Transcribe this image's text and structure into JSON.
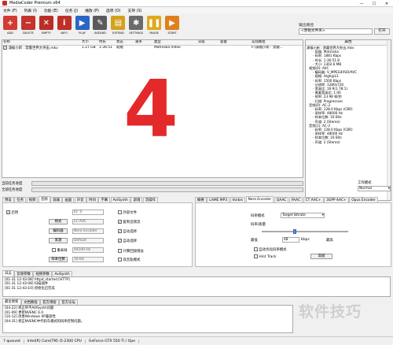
{
  "window": {
    "title": "MediaCoder Premium x64",
    "min": "—",
    "max": "☐",
    "close": "✕"
  },
  "menu": [
    "文件 (F)",
    "列表 (I)",
    "功能 (E)",
    "任务 (J)",
    "播放 (P)",
    "选项 (O)",
    "支持 (S)"
  ],
  "toolbar": [
    {
      "label": "ADD",
      "icon": "add-icon",
      "color": "#d23b32",
      "glyph": "+"
    },
    {
      "label": "DELETE",
      "icon": "delete-icon",
      "color": "#c4342c",
      "glyph": "−"
    },
    {
      "label": "EMPTY",
      "icon": "empty-icon",
      "color": "#b92e27",
      "glyph": "✕"
    },
    {
      "label": "INFO",
      "icon": "info-icon",
      "color": "#bf2f29",
      "glyph": "i"
    },
    {
      "label": "PLAY",
      "icon": "play-icon",
      "color": "#2a66c8",
      "glyph": "▶"
    },
    {
      "label": "WIZARD",
      "icon": "wizard-icon",
      "color": "#5a5a5a",
      "glyph": "✎"
    },
    {
      "label": "EXTEND",
      "icon": "extend-icon",
      "color": "#d4a020",
      "glyph": "▤"
    },
    {
      "label": "SETTINGS",
      "icon": "settings-icon",
      "color": "#6b6b6b",
      "glyph": "✱"
    },
    {
      "label": "PAUSE",
      "icon": "pause-icon",
      "color": "#e0a81c",
      "glyph": "❚❚"
    },
    {
      "label": "START",
      "icon": "start-icon",
      "color": "#e0801c",
      "glyph": "▶"
    }
  ],
  "output": {
    "label": "输出路径",
    "value": "<原始文件夹>",
    "browse": "打开"
  },
  "filelist": {
    "columns": [
      "名称",
      "大小",
      "时长",
      "状态",
      "速率",
      "类型",
      "分段",
      "容量",
      "实际路径"
    ],
    "rows": [
      [
        "浦福小新 : 禁震世界大突击.mkv",
        "1.27 GB",
        "1:36:51",
        "就绪",
        "",
        "Matroska Video",
        "",
        "",
        "F:\\浦福小新 : 禁震..."
      ]
    ]
  },
  "overlay_number": "4",
  "properties": {
    "header": "属性",
    "items": [
      "浦福小新 : 禁震世界大突击.mkv",
      "· 容器: Matroska",
      "· 码率: 1881 Kbps",
      "· 时长: 1:36:51.8",
      "· 大小: 1302.6 MB",
      "视频(0): AVC",
      "· 编码器: V_MPEG4/ISO/AVC",
      "· 规格: High@L3",
      "· 码率: 1500 Kbps",
      "· 分辨率: 1280x720",
      "· 宽高比: 16:9(1.78:1)",
      "· 像素宽高比: 1.00",
      "· 帧率: 23.98 帧/秒",
      "· 扫描: Progressive",
      "音频(0): AC-3",
      "· 码率: 128.0 Kbps (CBR)",
      "· 采样率: 48000 Hz",
      "· 样本位数: 16 Bits",
      "· 声道: 2 (Stereo)",
      "音频(1): AC-3",
      "· 码率: 128.0 Kbps (CBR)",
      "· 采样率: 48000 Hz",
      "· 样本位数: 16 Bits",
      "· 声道: 2 (Stereo)"
    ]
  },
  "progress": {
    "current": "当前任务进度",
    "overall": "全部任务进度"
  },
  "workmode": {
    "label": "工作模式",
    "value": "Normal"
  },
  "left_tabs": [
    "预设",
    "任务",
    "视频",
    "音频",
    "容器",
    "画面",
    "声音",
    "时间",
    "字幕",
    "AviSynth",
    "滤镜",
    "流操作"
  ],
  "left_active": 3,
  "audio_panel": {
    "enable": "启用",
    "track": "ID: 0",
    "external": "外部文件",
    "format_btn": "格式",
    "format_val": "LC-AAC",
    "encoder_btn": "编码器",
    "encoder_val": "Nero Encoder",
    "source_btn": "来源",
    "source_val": "Default",
    "resample_label": "重采样",
    "resample_val": "44100 Hz",
    "bits_btn": "样本位数",
    "bits_val": "16-bit",
    "opt_copy": "复制音频流",
    "opt_auto1": "自动选择",
    "opt_auto2": "自动选择",
    "opt_calc": "计算回放增益",
    "opt_dual": "双音轨模式"
  },
  "right_tabs": [
    "概要",
    "LAME MP3",
    "Vorbis",
    "Nero Encoder",
    "QAAC",
    "FAAC",
    "CT AAC+",
    "3GPP AAC+",
    "Opus Encoder"
  ],
  "right_active": 3,
  "nero_panel": {
    "mode_label": "码率模式",
    "mode_value": "Target Bitrate",
    "rate_label": "码率/质量",
    "min_label": "最低",
    "max_label": "最高",
    "rate_value": "48",
    "unit": "Kbps",
    "auto_opt": "自动优化码率模式",
    "hint": "Hint Track",
    "advanced": "高级",
    "slider_fraction": 0.38
  },
  "log_tabs": [
    "日志",
    "音频参数",
    "视频参数",
    "AviSynth"
  ],
  "log_lines": [
    "[01-31 12:43:08] httpd_started [HTTP]",
    "[01-31 12:43:08] 扫描插件",
    "[01-31 12:43:10] 初始化已完成"
  ],
  "news_tabs": [
    "最近更新",
    "文档教程",
    "官方博客",
    "官方论坛"
  ],
  "news_lines": [
    "[04-22] 修正带不AVISynth问题",
    "[01-09] 更新NVENC 6.0",
    "[10-12] 改善Windows XP兼容性",
    "[04-31] 修正NVENC中代码车模式的码率控制问题。"
  ],
  "watermark": "软件技巧",
  "status": [
    "7 queued",
    "Intel(R) Core(TM) i5-2300 CPU",
    "GeForce GTX 550 Ti / Ope"
  ]
}
